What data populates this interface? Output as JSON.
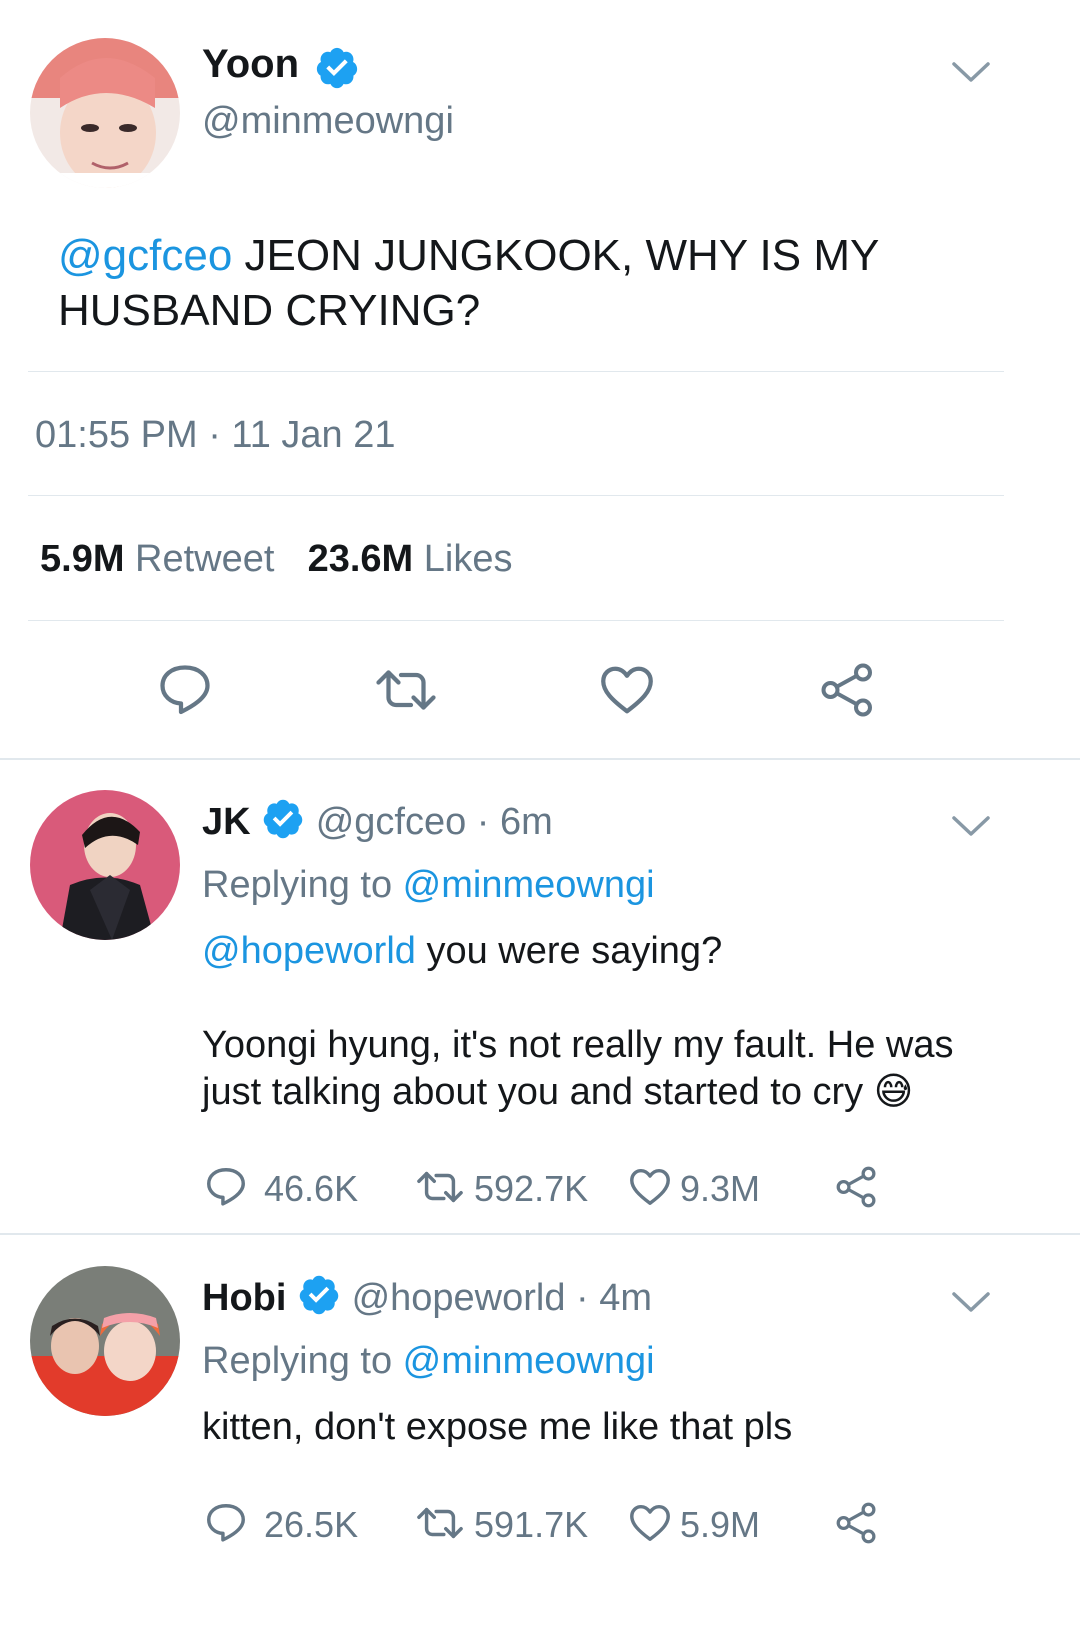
{
  "main_tweet": {
    "display_name": "Yoon",
    "handle": "@minmeowngi",
    "mention": "@gcfceo",
    "text_line1": " JEON JUNGKOOK, WHY IS MY",
    "text_line2": "HUSBAND CRYING?",
    "timestamp": "01:55 PM · 11 Jan 21",
    "retweet_count": "5.9M",
    "retweet_label": "Retweet",
    "likes_count": "23.6M",
    "likes_label": "Likes"
  },
  "replies": [
    {
      "display_name": "JK",
      "handle_time": "@gcfceo · 6m",
      "replying_prefix": "Replying to ",
      "replying_handle": "@minmeowngi",
      "mention": "@hopeworld",
      "text_line1": " you were saying?",
      "text_line2": "Yoongi hyung, it's not really my fault. He was",
      "text_line3": "just talking about you and started to cry",
      "emoji": "😅",
      "replies_count": "46.6K",
      "retweets_count": "592.7K",
      "likes_count": "9.3M"
    },
    {
      "display_name": "Hobi",
      "handle_time": "@hopeworld · 4m",
      "replying_prefix": "Replying to ",
      "replying_handle": "@minmeowngi",
      "text_line1": "kitten, don't expose me like that pls",
      "replies_count": "26.5K",
      "retweets_count": "591.7K",
      "likes_count": "5.9M"
    }
  ],
  "colors": {
    "link": "#1b95e0",
    "verified": "#1da1f2",
    "muted": "#657786",
    "icon": "#657786",
    "divider": "#e1e8ed"
  },
  "icons": [
    "verified-badge-icon",
    "chevron-down-icon",
    "reply-icon",
    "retweet-icon",
    "like-icon",
    "share-icon"
  ]
}
